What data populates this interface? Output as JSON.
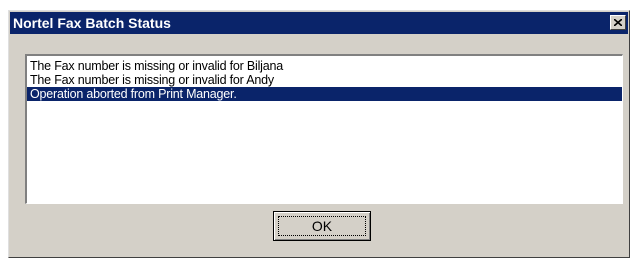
{
  "window": {
    "title": "Nortel Fax Batch Status",
    "close_icon": "close-icon"
  },
  "status_list": {
    "items": [
      {
        "text": "The Fax number is missing or invalid for Biljana",
        "selected": false
      },
      {
        "text": "The Fax number is missing or invalid for Andy",
        "selected": false
      },
      {
        "text": "Operation aborted from Print Manager.",
        "selected": true
      }
    ]
  },
  "buttons": {
    "ok_label": "OK"
  },
  "colors": {
    "titlebar": "#0a246a",
    "dialog_face": "#d4d0c8",
    "selection": "#0a246a"
  }
}
